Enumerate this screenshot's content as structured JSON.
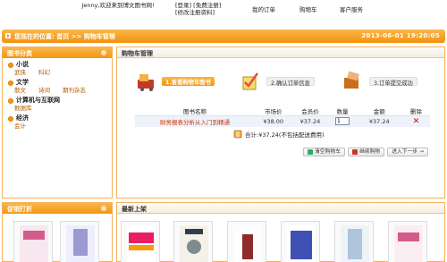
{
  "header": {
    "welcome": "Jenny,欢迎来到博文图书网!",
    "login": "[登录]",
    "register": "[免费注册]",
    "edit_profile": "[修改注册资料]",
    "nav": [
      "我的订单",
      "购物车",
      "客户服务"
    ]
  },
  "breadcrumb": {
    "prefix": "您现在的位置:",
    "home": "首页",
    "sep": ">>",
    "current": "购物车管理",
    "datetime": "2013-06-01 19:20:05"
  },
  "categories": {
    "title": "图书分类",
    "groups": [
      {
        "name": "小说",
        "subs": [
          "武侠",
          "科幻"
        ]
      },
      {
        "name": "文学",
        "subs": [
          "散文",
          "诗词",
          "期刊杂志"
        ]
      },
      {
        "name": "计算机与互联网",
        "subs": [
          "数据库"
        ]
      },
      {
        "name": "经济",
        "subs": [
          "会计"
        ]
      }
    ]
  },
  "cart": {
    "title": "购物车管理",
    "steps": [
      "1.查看购物车图书",
      "2.确认订单信息",
      "3.订单提交成功"
    ],
    "columns": [
      "图书名称",
      "市场价",
      "会员价",
      "数量",
      "金额",
      "删除"
    ],
    "rows": [
      {
        "name": "财务报表分析从入门到精通",
        "market": "¥38.00",
        "member": "¥37.24",
        "qty": "1",
        "amount": "¥37.24"
      }
    ],
    "total": "合计:¥37.24(不包括配送费用)",
    "buttons": [
      "清空购物车",
      "继续购物",
      "进入下一步"
    ]
  },
  "promo": {
    "title": "促销打折"
  },
  "new_arrivals": {
    "title": "最新上架"
  },
  "colors": {
    "accent": "#f3960f",
    "link": "#cc3300"
  }
}
